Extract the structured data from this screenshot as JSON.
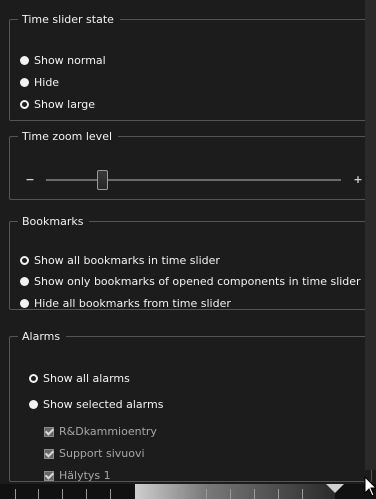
{
  "time_slider_state": {
    "title": "Time slider state",
    "options": [
      {
        "label": "Show normal",
        "selected": false
      },
      {
        "label": "Hide",
        "selected": false
      },
      {
        "label": "Show large",
        "selected": true
      }
    ]
  },
  "time_zoom_level": {
    "title": "Time zoom level",
    "minus_glyph": "−",
    "plus_glyph": "+",
    "level_fraction": 0.19
  },
  "bookmarks": {
    "title": "Bookmarks",
    "options": [
      {
        "label": "Show all bookmarks in time slider",
        "selected": true
      },
      {
        "label": "Show only bookmarks of opened components in time slider",
        "selected": false
      },
      {
        "label": "Hide all bookmarks from time slider",
        "selected": false
      }
    ]
  },
  "alarms": {
    "title": "Alarms",
    "options": [
      {
        "label": "Show all alarms",
        "selected": true
      },
      {
        "label": "Show selected alarms",
        "selected": false
      }
    ],
    "selected_alarms": [
      {
        "label": "R&Dkammioentry",
        "checked": true
      },
      {
        "label": "Support sivuovi",
        "checked": true
      },
      {
        "label": "Hälytys 1",
        "checked": true
      }
    ]
  }
}
